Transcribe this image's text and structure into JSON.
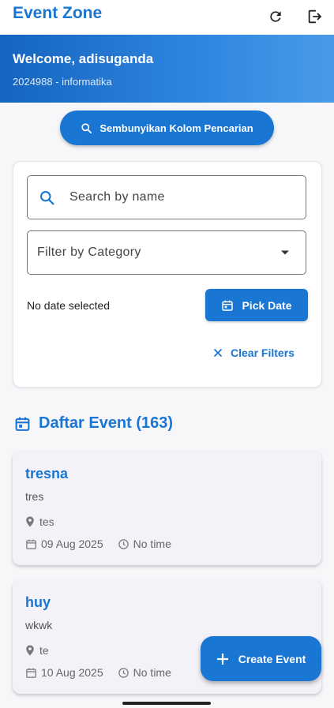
{
  "appbar": {
    "title": "Event Zone",
    "refresh_icon": "refresh-icon",
    "logout_icon": "logout-icon"
  },
  "welcome": {
    "title": "Welcome, adisuganda",
    "subtitle": "2024988 - informatika"
  },
  "search_toggle": {
    "label": "Sembunyikan Kolom Pencarian",
    "icon": "search-icon"
  },
  "filters": {
    "search_placeholder": "Search by name",
    "search_value": "",
    "category_placeholder": "Filter by Category",
    "date_status": "No date selected",
    "pick_date_label": "Pick Date",
    "clear_label": "Clear Filters"
  },
  "events_section": {
    "title": "Daftar Event (163)"
  },
  "events": [
    {
      "title": "tresna",
      "description": "tres",
      "location": "tes",
      "date": "09 Aug 2025",
      "time": "No time"
    },
    {
      "title": "huy",
      "description": "wkwk",
      "location": "te",
      "date": "10 Aug 2025",
      "time": "No time"
    }
  ],
  "fab": {
    "label": "Create Event",
    "icon": "plus-icon"
  },
  "colors": {
    "primary": "#1976d2",
    "card_bg": "#f4f1f8",
    "page_bg": "#f7f7fa"
  }
}
